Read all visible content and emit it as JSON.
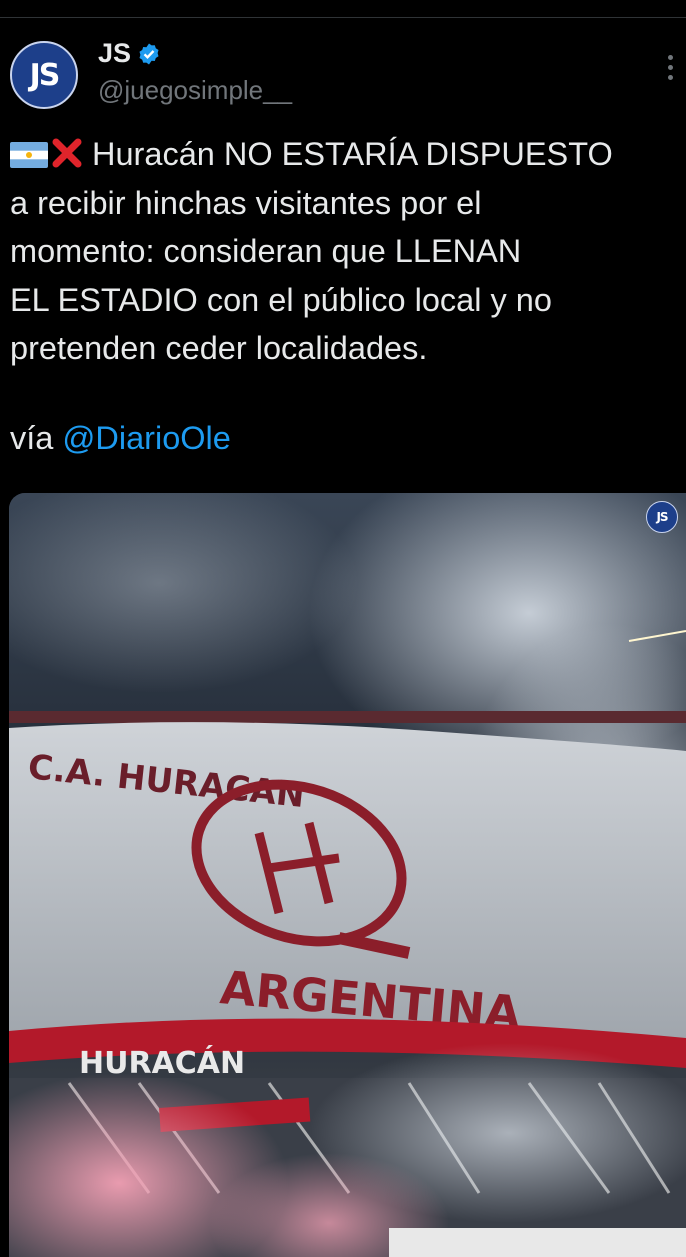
{
  "author": {
    "avatar_text": "JS",
    "name": "JS",
    "handle": "@juegosimple__",
    "verified_color": "#1d9bf0"
  },
  "tweet": {
    "text": "Huracán NO ESTARÍA DISPUESTO\na recibir hinchas visitantes por el\nmomento: consideran que LLENAN\nEL ESTADIO con el público local y no\npretenden ceder localidades.",
    "via_prefix": "vía ",
    "mention": "@DiarioOle"
  },
  "media": {
    "watermark_text": "JS",
    "banner_top_text": "C.A. HURACAN",
    "banner_bottom_text": "ARGENTINA",
    "lower_banner_text": "HURACÁN"
  },
  "icons": {
    "flag": "argentina-flag-emoji",
    "cross": "red-x-emoji",
    "more": "more-options-icon",
    "verified": "verified-badge-icon"
  }
}
